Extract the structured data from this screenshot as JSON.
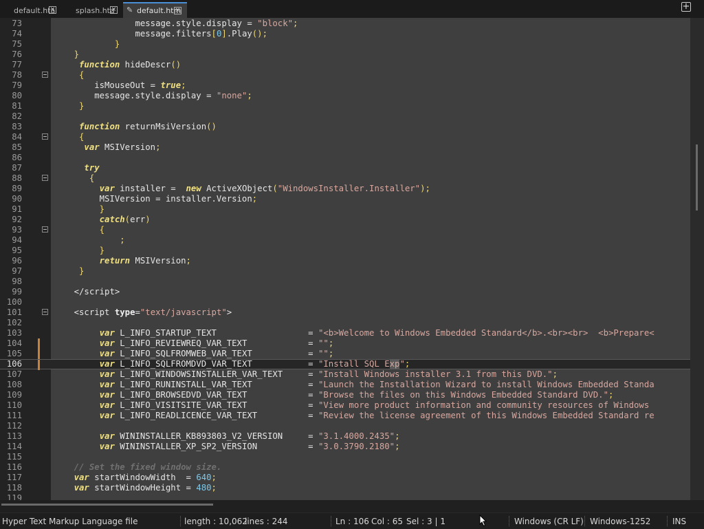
{
  "tabs": [
    {
      "label": "default.hta",
      "close": "×"
    },
    {
      "label": "splash.hta",
      "close": "×"
    },
    {
      "label": "default.htm",
      "close": "×",
      "active": true,
      "modified_icon": "pencil-icon"
    }
  ],
  "new_tab_label": "+",
  "editor": {
    "lines": [
      {
        "n": "73",
        "html": "                <span>message.style.display</span> = <span class=\"str\">\"block\"</span><span class=\"pun\">;</span>"
      },
      {
        "n": "74",
        "html": "                <span>message.filters</span><span class=\"pun\">[</span><span class=\"num\">0</span><span class=\"pun\">]</span>.Play<span class=\"pun\">()</span><span class=\"pun\">;</span>"
      },
      {
        "n": "75",
        "html": "            <span class=\"pun\">}</span>"
      },
      {
        "n": "76",
        "html": "    <span class=\"pun\">}</span>"
      },
      {
        "n": "77",
        "html": "     <span class=\"kw\">function</span> hideDescr<span class=\"pun\">()</span>"
      },
      {
        "n": "78",
        "html": "     <span class=\"pun\">{</span>",
        "fold": true
      },
      {
        "n": "79",
        "html": "        isMouseOut = <span class=\"kw\">true</span><span class=\"pun\">;</span>"
      },
      {
        "n": "80",
        "html": "        message.style.display = <span class=\"str\">\"none\"</span><span class=\"pun\">;</span>"
      },
      {
        "n": "81",
        "html": "     <span class=\"pun\">}</span>"
      },
      {
        "n": "82",
        "html": ""
      },
      {
        "n": "83",
        "html": "     <span class=\"kw\">function</span> returnMsiVersion<span class=\"pun\">()</span>"
      },
      {
        "n": "84",
        "html": "     <span class=\"pun\">{</span>",
        "fold": true
      },
      {
        "n": "85",
        "html": "      <span class=\"kw\">var</span> MSIVersion<span class=\"pun\">;</span>"
      },
      {
        "n": "86",
        "html": ""
      },
      {
        "n": "87",
        "html": "      <span class=\"kw\">try</span>"
      },
      {
        "n": "88",
        "html": "       <span class=\"pun\">{</span>",
        "fold": true
      },
      {
        "n": "89",
        "html": "         <span class=\"kw\">var</span> installer =  <span class=\"kw\">new</span> ActiveXObject<span class=\"pun\">(</span><span class=\"str\">\"WindowsInstaller.Installer\"</span><span class=\"pun\">)</span><span class=\"pun\">;</span>"
      },
      {
        "n": "90",
        "html": "         MSIVersion = installer.Version<span class=\"pun\">;</span>"
      },
      {
        "n": "91",
        "html": "         <span class=\"pun\">}</span>"
      },
      {
        "n": "92",
        "html": "         <span class=\"kw\">catch</span><span class=\"pun\">(</span>err<span class=\"pun\">)</span>"
      },
      {
        "n": "93",
        "html": "         <span class=\"pun\">{</span>",
        "fold": true
      },
      {
        "n": "94",
        "html": "             <span class=\"pun\">;</span>"
      },
      {
        "n": "95",
        "html": "         <span class=\"pun\">}</span>"
      },
      {
        "n": "96",
        "html": "         <span class=\"kw\">return</span> MSIVersion<span class=\"pun\">;</span>"
      },
      {
        "n": "97",
        "html": "     <span class=\"pun\">}</span>"
      },
      {
        "n": "98",
        "html": ""
      },
      {
        "n": "99",
        "html": "    <span class=\"tag\">&lt;/script&gt;</span>"
      },
      {
        "n": "100",
        "html": ""
      },
      {
        "n": "101",
        "html": "    <span class=\"tag\">&lt;script</span> <span class=\"attr\">type</span>=<span class=\"str\">\"text/javascript\"</span><span class=\"tag\">&gt;</span>",
        "fold": true
      },
      {
        "n": "102",
        "html": ""
      },
      {
        "n": "103",
        "html": "         <span class=\"kw\">var</span> L_INFO_STARTUP_TEXT                  = <span class=\"str\">\"&lt;b&gt;Welcome to Windows Embedded Standard&lt;/b&gt;.&lt;br&gt;&lt;br&gt;  &lt;b&gt;Prepare&lt;</span>"
      },
      {
        "n": "104",
        "html": "         <span class=\"kw\">var</span> L_INFO_REVIEWREQ_VAR_TEXT            = <span class=\"str\">\"\"</span><span class=\"pun\">;</span>",
        "changed": true
      },
      {
        "n": "105",
        "html": "         <span class=\"kw\">var</span> L_INFO_SQLFROMWEB_VAR_TEXT           = <span class=\"str\">\"\"</span><span class=\"pun\">;</span>",
        "changed": true
      },
      {
        "n": "106",
        "html": "         <span class=\"kw\">var</span> L_INFO_SQLFROMDVD_VAR_TEXT           = <span class=\"str\">\"Install SQL E<span class=\"sel\">xp</span>\"</span><span class=\"pun\">;</span>",
        "changed": true,
        "current": true
      },
      {
        "n": "107",
        "html": "         <span class=\"kw\">var</span> L_INFO_WINDOWSINSTALLER_VAR_TEXT     = <span class=\"str\">\"Install Windows installer 3.1 from this DVD.\"</span><span class=\"pun\">;</span>"
      },
      {
        "n": "108",
        "html": "         <span class=\"kw\">var</span> L_INFO_RUNINSTALL_VAR_TEXT           = <span class=\"str\">\"Launch the Installation Wizard to install Windows Embedded Standa</span>"
      },
      {
        "n": "109",
        "html": "         <span class=\"kw\">var</span> L_INFO_BROWSEDVD_VAR_TEXT            = <span class=\"str\">\"Browse the files on this Windows Embedded Standard DVD.\"</span><span class=\"pun\">;</span>"
      },
      {
        "n": "110",
        "html": "         <span class=\"kw\">var</span> L_INFO_VISITSITE_VAR_TEXT            = <span class=\"str\">\"View more product information and community resources of Windows</span>"
      },
      {
        "n": "111",
        "html": "         <span class=\"kw\">var</span> L_INFO_READLICENCE_VAR_TEXT          = <span class=\"str\">\"Review the license agreement of this Windows Embedded Standard re</span>"
      },
      {
        "n": "112",
        "html": ""
      },
      {
        "n": "113",
        "html": "         <span class=\"kw\">var</span> WININSTALLER_KB893803_V2_VERSION     = <span class=\"str\">\"3.1.4000.2435\"</span><span class=\"pun\">;</span>"
      },
      {
        "n": "114",
        "html": "         <span class=\"kw\">var</span> WININSTALLER_XP_SP2_VERSION          = <span class=\"str\">\"3.0.3790.2180\"</span><span class=\"pun\">;</span>"
      },
      {
        "n": "115",
        "html": ""
      },
      {
        "n": "116",
        "html": "    <span class=\"cmt\">// Set the fixed window size.</span>"
      },
      {
        "n": "117",
        "html": "    <span class=\"kw\">var</span> startWindowWidth  = <span class=\"num\">640</span><span class=\"pun\">;</span>"
      },
      {
        "n": "118",
        "html": "    <span class=\"kw\">var</span> startWindowHeight = <span class=\"num\">480</span><span class=\"pun\">;</span>"
      },
      {
        "n": "119",
        "html": ""
      }
    ]
  },
  "status": {
    "file_type": "Hyper Text Markup Language file",
    "length": "length : 10,062",
    "lines": "lines : 244",
    "ln": "Ln : 106",
    "col": "Col : 65",
    "sel": "Sel : 3 | 1",
    "eol": "Windows (CR LF)",
    "encoding": "Windows-1252",
    "mode": "INS"
  }
}
